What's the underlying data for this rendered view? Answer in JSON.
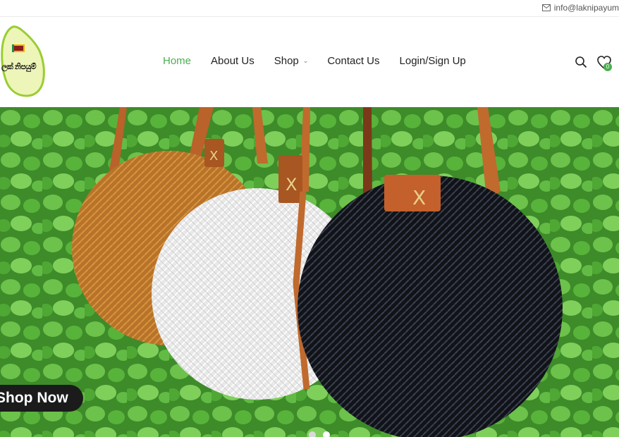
{
  "topbar": {
    "email": "info@laknipayum",
    "email_icon": "mail-icon"
  },
  "header": {
    "logo_text": "ලක් නිපයුම්",
    "nav": {
      "home": "Home",
      "about": "About Us",
      "shop": "Shop",
      "contact": "Contact Us",
      "login": "Login/Sign Up",
      "active": "Home"
    },
    "wishlist_count": "0",
    "icons": [
      "search-icon",
      "heart-icon",
      "chevron-down-icon"
    ]
  },
  "hero": {
    "cta_label": "Shop Now",
    "slide_count": 2,
    "active_slide": 2
  },
  "colors": {
    "accent": "#4caf50",
    "cta_bg": "#1b1b1b"
  }
}
